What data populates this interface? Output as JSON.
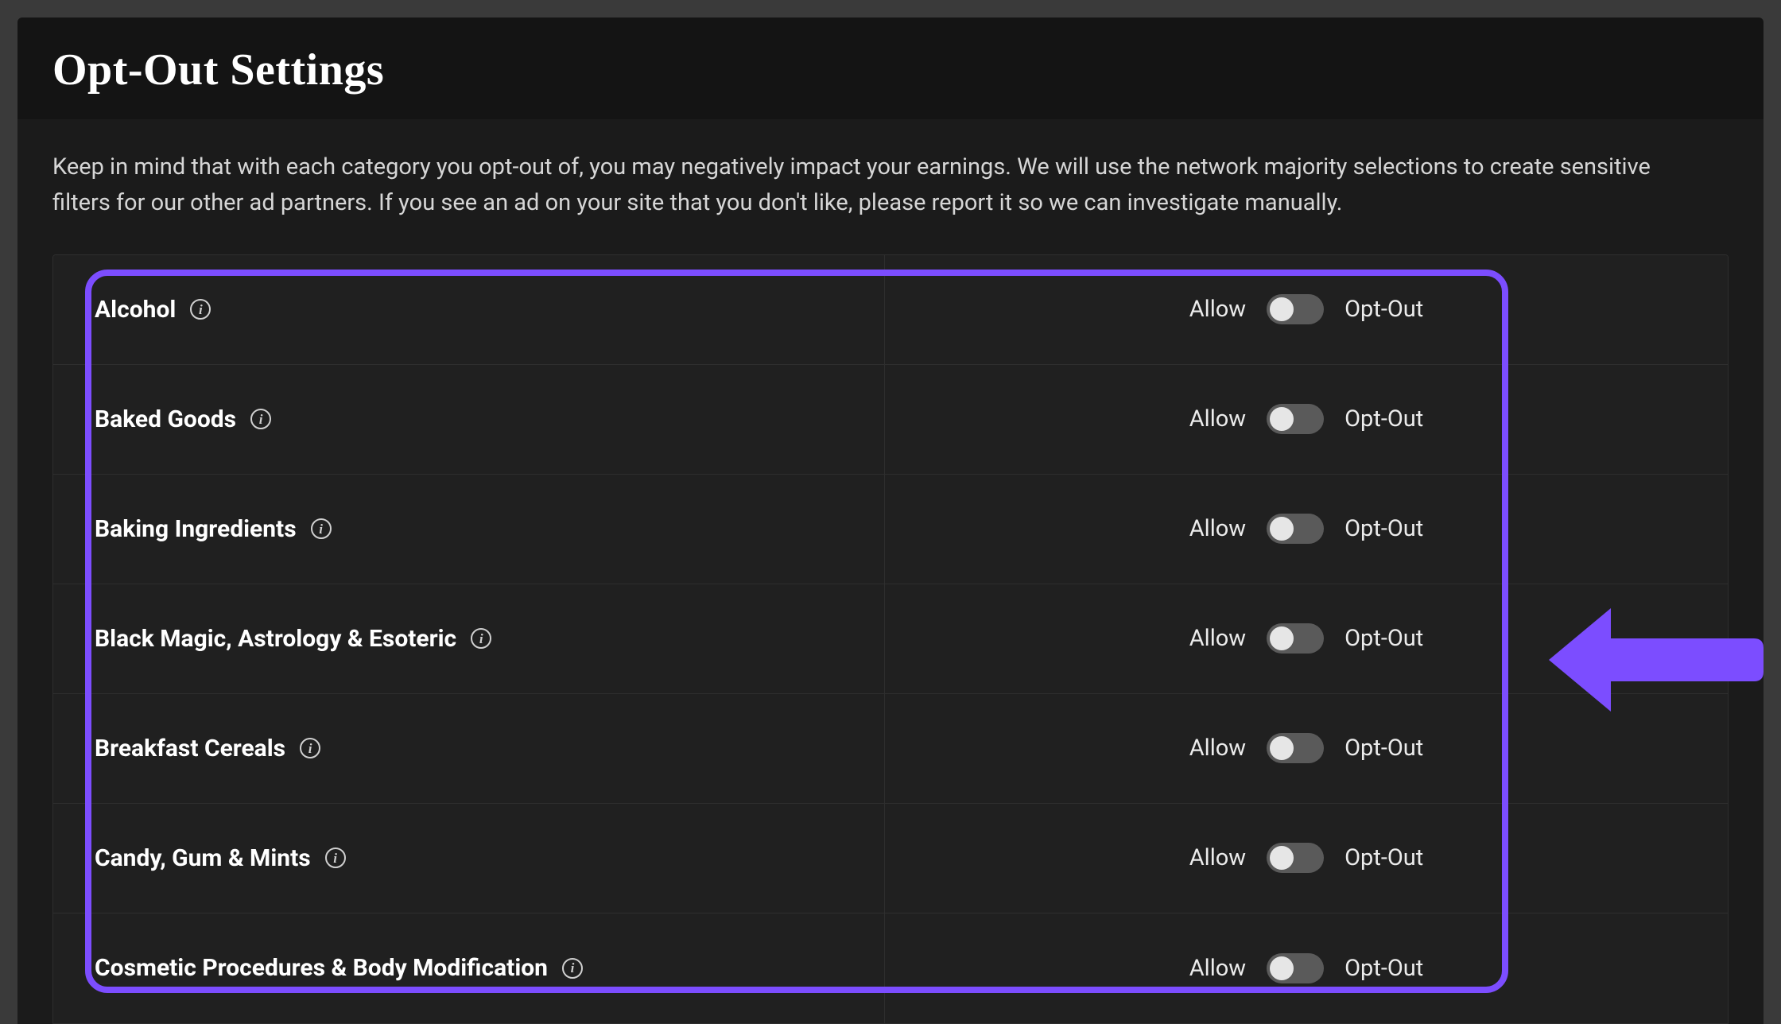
{
  "header": {
    "title": "Opt-Out Settings"
  },
  "blurb": "Keep in mind that with each category you opt-out of, you may negatively impact your earnings. We will use the network majority selections to create sensitive filters for our other ad partners. If you see an ad on your site that you don't like, please report it so we can investigate manually.",
  "toggle_labels": {
    "allow": "Allow",
    "optout": "Opt-Out"
  },
  "categories": [
    {
      "name": "Alcohol",
      "state": "allow"
    },
    {
      "name": "Baked Goods",
      "state": "allow"
    },
    {
      "name": "Baking Ingredients",
      "state": "allow"
    },
    {
      "name": "Black Magic, Astrology & Esoteric",
      "state": "allow"
    },
    {
      "name": "Breakfast Cereals",
      "state": "allow"
    },
    {
      "name": "Candy, Gum & Mints",
      "state": "allow"
    },
    {
      "name": "Cosmetic Procedures & Body Modification",
      "state": "allow"
    }
  ],
  "annotation": {
    "highlight_color": "#7c4dff",
    "arrow_direction": "left"
  }
}
